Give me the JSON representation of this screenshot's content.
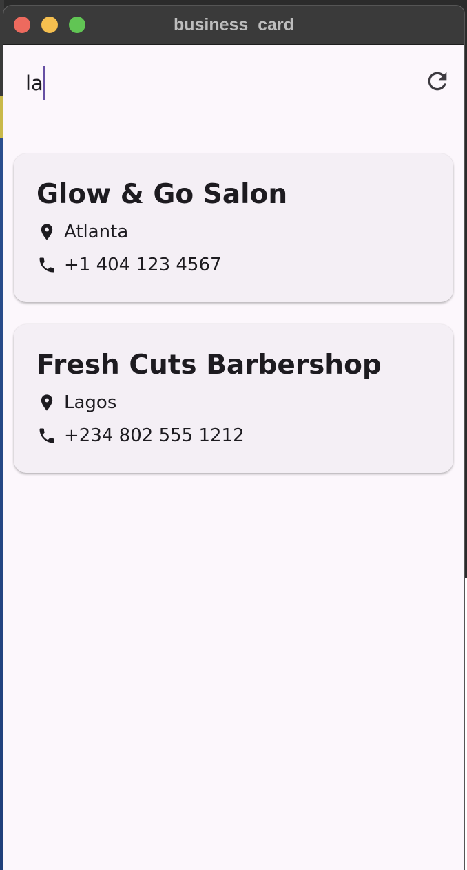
{
  "window": {
    "title": "business_card"
  },
  "search": {
    "value": "la"
  },
  "colors": {
    "accent": "#6750a4",
    "card_background": "#f4eff5",
    "page_background": "#fcf7fc",
    "text": "#1d1b20"
  },
  "businesses": [
    {
      "name": "Glow & Go Salon",
      "location": "Atlanta",
      "phone": "+1 404 123 4567",
      "location_icon": "location-pin-icon",
      "phone_icon": "phone-icon"
    },
    {
      "name": "Fresh Cuts Barbershop",
      "location": "Lagos",
      "phone": "+234 802 555 1212",
      "location_icon": "location-pin-icon",
      "phone_icon": "phone-icon"
    }
  ],
  "toolbar": {
    "refresh_icon": "refresh-icon"
  }
}
